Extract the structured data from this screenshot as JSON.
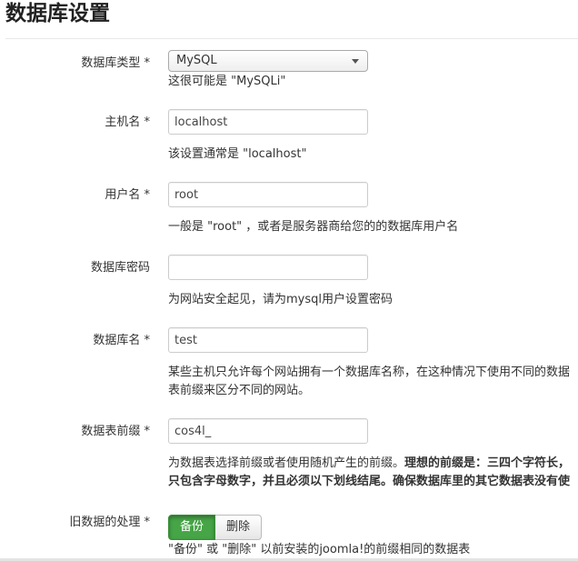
{
  "page": {
    "title": "数据库设置"
  },
  "fields": {
    "db_type": {
      "label": "数据库类型 *",
      "selected": "MySQL",
      "help": "这很可能是 \"MySQLi\""
    },
    "host": {
      "label": "主机名 *",
      "value": "localhost",
      "help": "该设置通常是 \"localhost\""
    },
    "user": {
      "label": "用户名 *",
      "value": "root",
      "help": "一般是 \"root\" ，或者是服务器商给您的的数据库用户名"
    },
    "password": {
      "label": "数据库密码",
      "value": "",
      "help": "为网站安全起见，请为mysql用户设置密码"
    },
    "db_name": {
      "label": "数据库名 *",
      "value": "test",
      "help": "某些主机只允许每个网站拥有一个数据库名称，在这种情况下使用不同的数据表前缀来区分不同的网站。"
    },
    "prefix": {
      "label": "数据表前缀 *",
      "value": "cos4l_",
      "help_plain": "为数据表选择前缀或者使用随机产生的前缀。",
      "help_bold": "理想的前缀是：三四个字符长，只包含字母数字，并且必须以下划线结尾。确保数据库里的其它数据表没有使用该前缀。一般也不要使用 \"bak_\" ，因该前缀已被系统占用。"
    },
    "old_data": {
      "label": "旧数据的处理 *",
      "backup_label": "备份",
      "remove_label": "删除",
      "help": "\"备份\" 或 \"删除\" 以前安装的joomla!的前缀相同的数据表"
    }
  },
  "colors": {
    "active_button": "#46a546"
  }
}
